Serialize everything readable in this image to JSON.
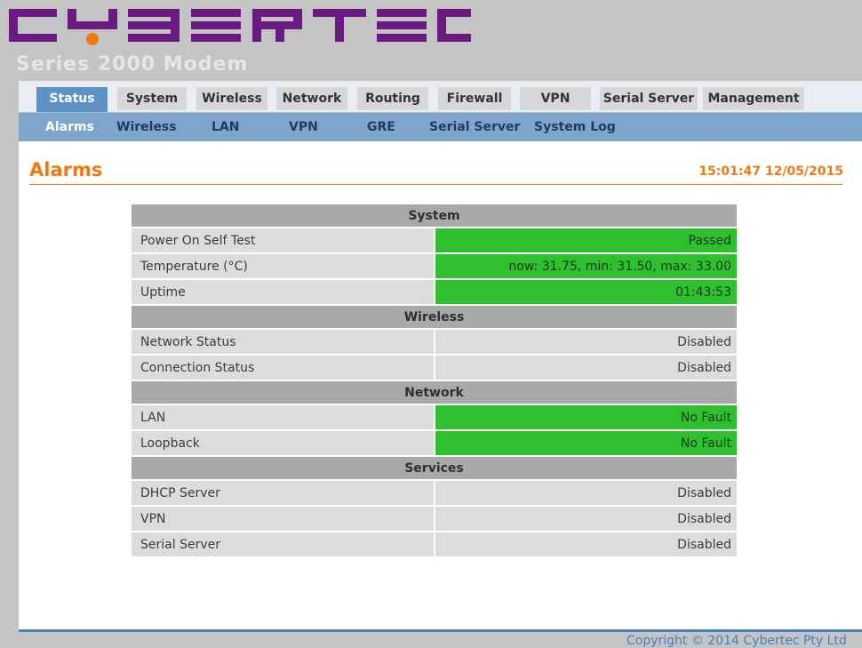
{
  "brand": {
    "logo_text": "CYBERTEC",
    "product_name": "Series 2000 Modem",
    "logo_colors": {
      "letters": "#6b1a82",
      "dot": "#f07a10"
    }
  },
  "nav": {
    "tabs": [
      {
        "label": "Status",
        "active": true
      },
      {
        "label": "System",
        "active": false
      },
      {
        "label": "Wireless",
        "active": false
      },
      {
        "label": "Network",
        "active": false
      },
      {
        "label": "Routing",
        "active": false
      },
      {
        "label": "Firewall",
        "active": false
      },
      {
        "label": "VPN",
        "active": false
      },
      {
        "label": "Serial Server",
        "active": false
      },
      {
        "label": "Management",
        "active": false
      }
    ],
    "subtabs": [
      {
        "label": "Alarms",
        "active": true
      },
      {
        "label": "Wireless",
        "active": false
      },
      {
        "label": "LAN",
        "active": false
      },
      {
        "label": "VPN",
        "active": false
      },
      {
        "label": "GRE",
        "active": false
      },
      {
        "label": "Serial Server",
        "active": false
      },
      {
        "label": "System Log",
        "active": false
      }
    ]
  },
  "page": {
    "title": "Alarms",
    "timestamp": "15:01:47 12/05/2015"
  },
  "alarms": {
    "sections": [
      {
        "title": "System",
        "rows": [
          {
            "label": "Power On Self Test",
            "value": "Passed",
            "status": "ok"
          },
          {
            "label": "Temperature (°C)",
            "value": "now: 31.75, min: 31.50, max: 33.00",
            "status": "ok"
          },
          {
            "label": "Uptime",
            "value": "01:43:53",
            "status": "ok"
          }
        ]
      },
      {
        "title": "Wireless",
        "rows": [
          {
            "label": "Network Status",
            "value": "Disabled",
            "status": "neutral"
          },
          {
            "label": "Connection Status",
            "value": "Disabled",
            "status": "neutral"
          }
        ]
      },
      {
        "title": "Network",
        "rows": [
          {
            "label": "LAN",
            "value": "No Fault",
            "status": "ok"
          },
          {
            "label": "Loopback",
            "value": "No Fault",
            "status": "ok"
          }
        ]
      },
      {
        "title": "Services",
        "rows": [
          {
            "label": "DHCP Server",
            "value": "Disabled",
            "status": "neutral"
          },
          {
            "label": "VPN",
            "value": "Disabled",
            "status": "neutral"
          },
          {
            "label": "Serial Server",
            "value": "Disabled",
            "status": "neutral"
          }
        ]
      }
    ]
  },
  "footer": {
    "copyright": "Copyright © 2014 Cybertec Pty Ltd"
  },
  "colors": {
    "accent": "#f07a10",
    "tab_active": "#5d92c2",
    "subbar": "#7ea6cc",
    "status_ok": "#2ec02e",
    "status_neutral": "#dcdcdc",
    "section_header": "#a9a9a9"
  }
}
